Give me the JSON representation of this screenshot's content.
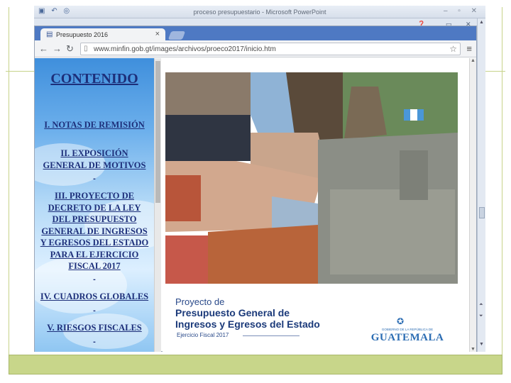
{
  "ppt": {
    "window_title": "proceso presupuestario  -  Microsoft PowerPoint",
    "quick_access": "▣ ↶ ◎",
    "window_controls": "–  ▫  ✕"
  },
  "browser": {
    "tab_title": "Presupuesto 2016",
    "url": "www.minfin.gob.gt/images/archivos/proeco2017/inicio.htm"
  },
  "menu": {
    "title": "CONTENIDO",
    "items": [
      {
        "label": "I. NOTAS DE REMISIÓN"
      },
      {
        "label": "II. EXPOSICIÓN\nGENERAL DE MOTIVOS"
      },
      {
        "label": "III. PROYECTO DE\nDECRETO DE LA LEY\nDEL PRESUPUESTO\nGENERAL DE INGRESOS\nY EGRESOS DEL ESTADO\nPARA EL EJERCICIO\nFISCAL 2017"
      },
      {
        "label": "IV. CUADROS GLOBALES"
      },
      {
        "label": "V. RIESGOS FISCALES"
      }
    ],
    "separator": "-"
  },
  "cover": {
    "line1": "Proyecto de",
    "line2": "Presupuesto General de",
    "line3": "Ingresos y Egresos del Estado",
    "subtitle": "Ejercicio Fiscal 2017",
    "logo_small": "GOBIERNO DE LA REPÚBLICA DE",
    "logo_big": "GUATEMALA"
  },
  "colors": {
    "menu_text": "#1d2f7a",
    "tabstrip": "#4e79c3",
    "cover_title": "#1b3a7a",
    "logo": "#2c6db3",
    "slide_band": "#c8d68a"
  }
}
